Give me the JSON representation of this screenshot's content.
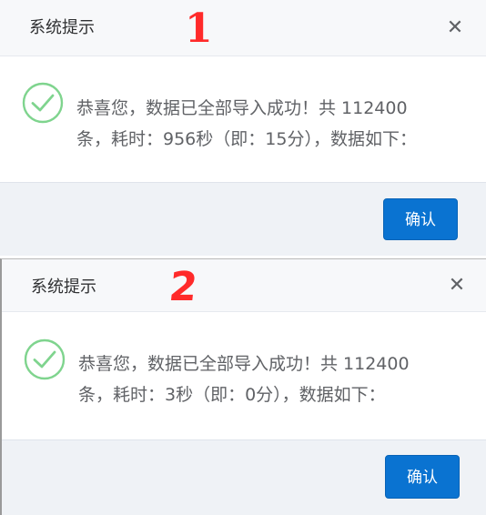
{
  "dialogs": [
    {
      "title": "系统提示",
      "close_icon": "close-icon",
      "annotation": "1",
      "message_line1": "恭喜您，数据已全部导入成功！共 112400",
      "message_line2": "条，耗时：956秒（即：15分），数据如下：",
      "confirm_label": "确认"
    },
    {
      "title": "系统提示",
      "close_icon": "close-icon",
      "annotation": "2",
      "message_line1": "恭喜您，数据已全部导入成功！共 112400",
      "message_line2": "条，耗时：3秒（即：0分），数据如下：",
      "confirm_label": "确认"
    }
  ],
  "colors": {
    "primary_button": "#0a73d1",
    "success_icon": "#67c23a",
    "annotation": "#ff2a2a",
    "header_bg": "#f7f8fa",
    "footer_bg": "#eff2f6"
  }
}
